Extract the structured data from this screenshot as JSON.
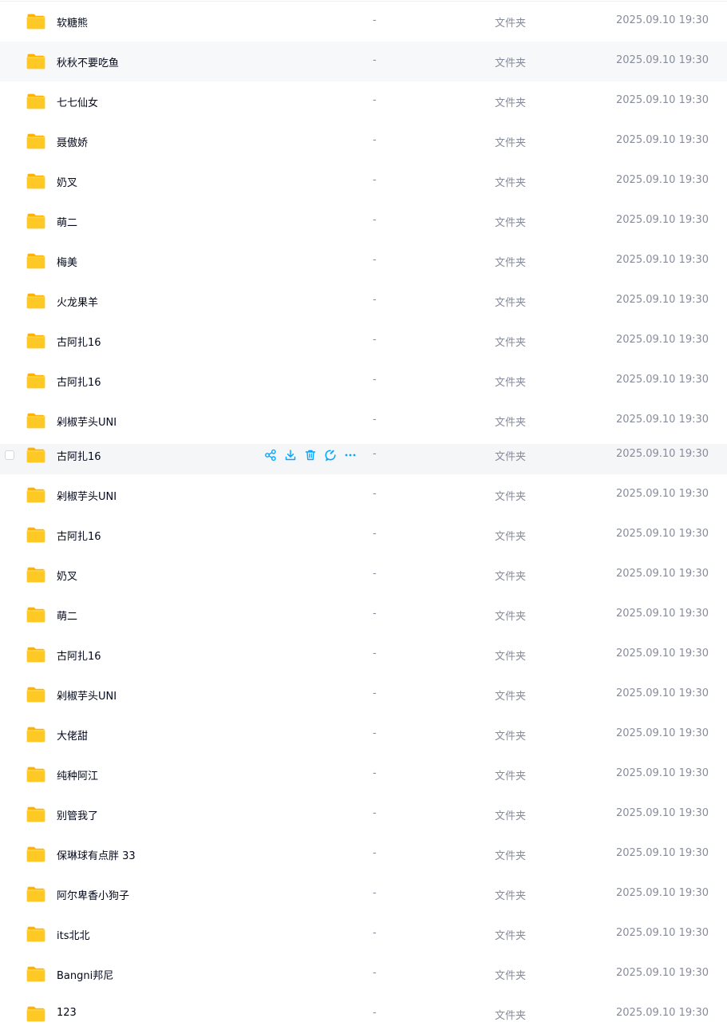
{
  "icons": {
    "folder": "folder-icon",
    "share": "share-icon",
    "download": "download-icon",
    "delete": "trash-icon",
    "rename": "rename-icon",
    "more": "more-icon"
  },
  "colors": {
    "folder": "#ffc400",
    "action": "#06a7ff",
    "hover_row": "#f5f6f8",
    "alt_row": "#f7f8fa"
  },
  "rows": [
    {
      "name": "软糖熊",
      "size": "-",
      "type": "文件夹",
      "date": "2025.09.10 19:30"
    },
    {
      "name": "秋秋不要吃鱼",
      "size": "-",
      "type": "文件夹",
      "date": "2025.09.10 19:30"
    },
    {
      "name": "七七仙女",
      "size": "-",
      "type": "文件夹",
      "date": "2025.09.10 19:30"
    },
    {
      "name": "聂傲娇",
      "size": "-",
      "type": "文件夹",
      "date": "2025.09.10 19:30"
    },
    {
      "name": "奶叉",
      "size": "-",
      "type": "文件夹",
      "date": "2025.09.10 19:30"
    },
    {
      "name": "萌二",
      "size": "-",
      "type": "文件夹",
      "date": "2025.09.10 19:30"
    },
    {
      "name": "梅美",
      "size": "-",
      "type": "文件夹",
      "date": "2025.09.10 19:30"
    },
    {
      "name": "火龙果羊",
      "size": "-",
      "type": "文件夹",
      "date": "2025.09.10 19:30"
    },
    {
      "name": "古阿扎16",
      "size": "-",
      "type": "文件夹",
      "date": "2025.09.10 19:30"
    },
    {
      "name": "古阿扎16",
      "size": "-",
      "type": "文件夹",
      "date": "2025.09.10 19:30"
    },
    {
      "name": "剁椒芋头UNI",
      "size": "-",
      "type": "文件夹",
      "date": "2025.09.10 19:30"
    },
    {
      "name": "古阿扎16",
      "size": "-",
      "type": "文件夹",
      "date": "2025.09.10 19:30"
    },
    {
      "name": "剁椒芋头UNI",
      "size": "-",
      "type": "文件夹",
      "date": "2025.09.10 19:30"
    },
    {
      "name": "古阿扎16",
      "size": "-",
      "type": "文件夹",
      "date": "2025.09.10 19:30"
    },
    {
      "name": "奶叉",
      "size": "-",
      "type": "文件夹",
      "date": "2025.09.10 19:30"
    },
    {
      "name": "萌二",
      "size": "-",
      "type": "文件夹",
      "date": "2025.09.10 19:30"
    },
    {
      "name": "古阿扎16",
      "size": "-",
      "type": "文件夹",
      "date": "2025.09.10 19:30"
    },
    {
      "name": "剁椒芋头UNI",
      "size": "-",
      "type": "文件夹",
      "date": "2025.09.10 19:30"
    },
    {
      "name": "大佬甜",
      "size": "-",
      "type": "文件夹",
      "date": "2025.09.10 19:30"
    },
    {
      "name": "纯种阿江",
      "size": "-",
      "type": "文件夹",
      "date": "2025.09.10 19:30"
    },
    {
      "name": "别管我了",
      "size": "-",
      "type": "文件夹",
      "date": "2025.09.10 19:30"
    },
    {
      "name": "保琳球有点胖 33",
      "size": "-",
      "type": "文件夹",
      "date": "2025.09.10 19:30"
    },
    {
      "name": "阿尔卑香小狗子",
      "size": "-",
      "type": "文件夹",
      "date": "2025.09.10 19:30"
    },
    {
      "name": "its北北",
      "size": "-",
      "type": "文件夹",
      "date": "2025.09.10 19:30"
    },
    {
      "name": "Bangni邦尼",
      "size": "-",
      "type": "文件夹",
      "date": "2025.09.10 19:30"
    },
    {
      "name": "123",
      "size": "-",
      "type": "文件夹",
      "date": "2025.09.10 19:30"
    }
  ]
}
